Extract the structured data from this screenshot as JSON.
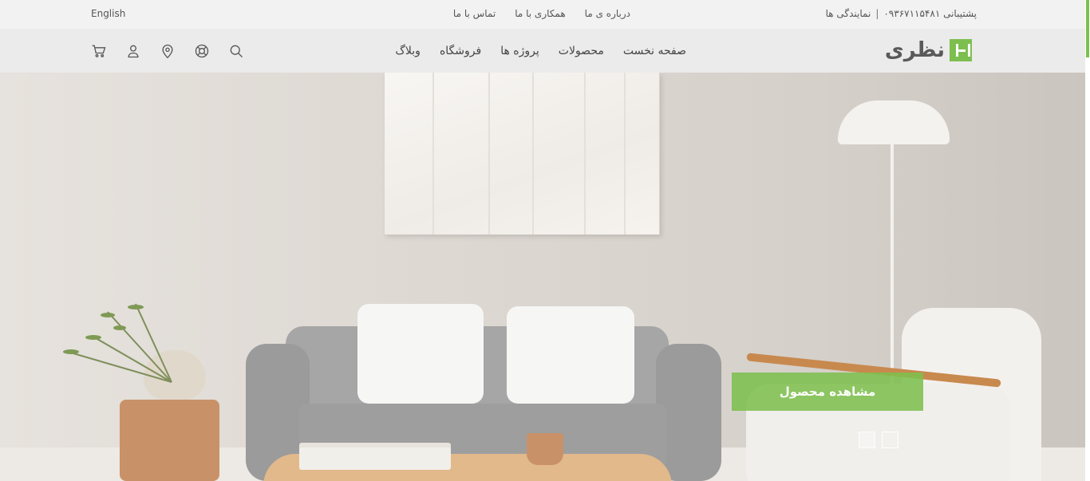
{
  "topbar": {
    "language": "English",
    "links": [
      "درباره ی ما",
      "همکاری با ما",
      "تماس با ما"
    ],
    "support_label": "پشتیبانی ۰۹۳۶۷۱۱۵۴۸۱",
    "separator": "|",
    "dealers_label": "نمایندگی ها"
  },
  "header": {
    "logo_text": "نظری",
    "nav": [
      "صفحه نخست",
      "محصولات",
      "پروژه ها",
      "فروشگاه",
      "وبلاگ"
    ],
    "icons": [
      "cart-icon",
      "user-icon",
      "location-icon",
      "support-icon",
      "search-icon"
    ]
  },
  "hero": {
    "cta_label": "مشاهده محصول",
    "slides_count": 2,
    "active_slide": 2
  },
  "colors": {
    "accent": "#7dbf4f",
    "topbar_bg": "#f2f2f2",
    "header_bg": "#ebebeb"
  }
}
